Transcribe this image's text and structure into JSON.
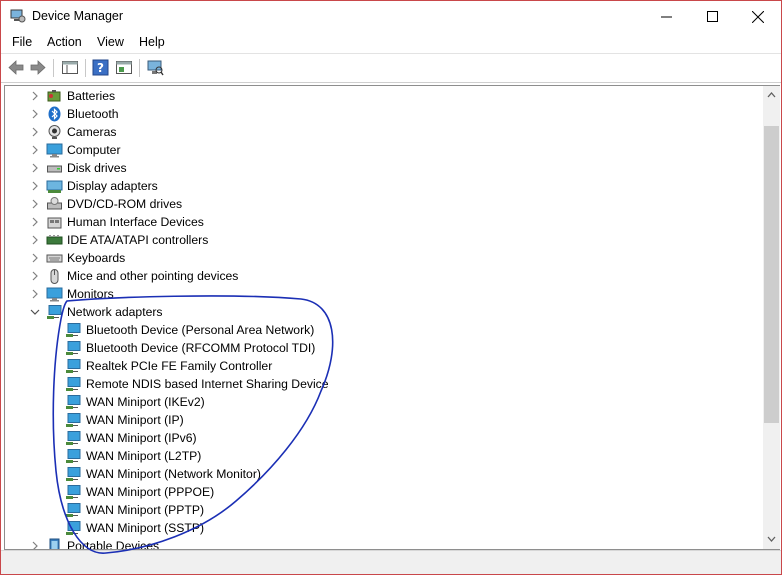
{
  "window": {
    "title": "Device Manager"
  },
  "menu": [
    "File",
    "Action",
    "View",
    "Help"
  ],
  "tree": {
    "categories_top": [
      {
        "label": "Batteries",
        "icon": "battery-icon"
      },
      {
        "label": "Bluetooth",
        "icon": "bluetooth-icon"
      },
      {
        "label": "Cameras",
        "icon": "camera-icon"
      },
      {
        "label": "Computer",
        "icon": "computer-icon"
      },
      {
        "label": "Disk drives",
        "icon": "disk-drive-icon"
      },
      {
        "label": "Display adapters",
        "icon": "display-adapter-icon"
      },
      {
        "label": "DVD/CD-ROM drives",
        "icon": "dvd-drive-icon"
      },
      {
        "label": "Human Interface Devices",
        "icon": "hid-icon"
      },
      {
        "label": "IDE ATA/ATAPI controllers",
        "icon": "ide-controller-icon"
      },
      {
        "label": "Keyboards",
        "icon": "keyboard-icon"
      },
      {
        "label": "Mice and other pointing devices",
        "icon": "mouse-icon"
      },
      {
        "label": "Monitors",
        "icon": "monitor-icon"
      }
    ],
    "expanded": {
      "label": "Network adapters",
      "icon": "network-adapter-icon",
      "children": [
        "Bluetooth Device (Personal Area Network)",
        "Bluetooth Device (RFCOMM Protocol TDI)",
        "Realtek PCIe FE Family Controller",
        "Remote NDIS based Internet Sharing Device",
        "WAN Miniport (IKEv2)",
        "WAN Miniport (IP)",
        "WAN Miniport (IPv6)",
        "WAN Miniport (L2TP)",
        "WAN Miniport (Network Monitor)",
        "WAN Miniport (PPPOE)",
        "WAN Miniport (PPTP)",
        "WAN Miniport (SSTP)"
      ]
    },
    "categories_bottom": [
      {
        "label": "Portable Devices",
        "icon": "portable-device-icon"
      }
    ]
  },
  "colors": {
    "window_border": "#c9474a",
    "annotation_ink": "#1b2fb5",
    "network_icon": "#3aa0dc"
  }
}
